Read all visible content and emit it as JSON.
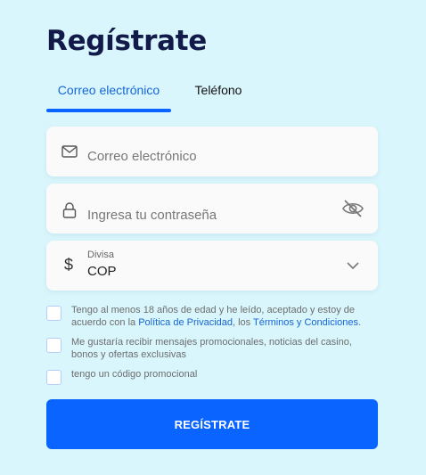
{
  "title": "Regístrate",
  "tabs": [
    {
      "label": "Correo electrónico",
      "active": true
    },
    {
      "label": "Teléfono",
      "active": false
    }
  ],
  "email": {
    "placeholder": "Correo electrónico"
  },
  "password": {
    "placeholder": "Ingresa tu contraseña"
  },
  "currency": {
    "label": "Divisa",
    "symbol": "$",
    "value": "COP"
  },
  "terms": {
    "prefix": "Tengo al menos 18 años de edad y he leído, aceptado y estoy de acuerdo con la ",
    "privacy_link": "Política de Privacidad",
    "middle": ", los ",
    "terms_link": "Términos y Condiciones",
    "suffix": "."
  },
  "promos_label": "Me gustaría recibir mensajes promocionales, noticias del casino, bonos y ofertas exclusivas",
  "promo_code_label": "tengo un código promocional",
  "submit_label": "REGÍSTRATE",
  "colors": {
    "background": "#d9f6fc",
    "accent": "#0a64ff",
    "title": "#121a4a",
    "link": "#1565d8"
  },
  "icons": {
    "email": "mail-icon",
    "password": "lock-icon",
    "toggle": "eye-off-icon",
    "currency": "dollar-icon",
    "dropdown": "chevron-down-icon"
  }
}
